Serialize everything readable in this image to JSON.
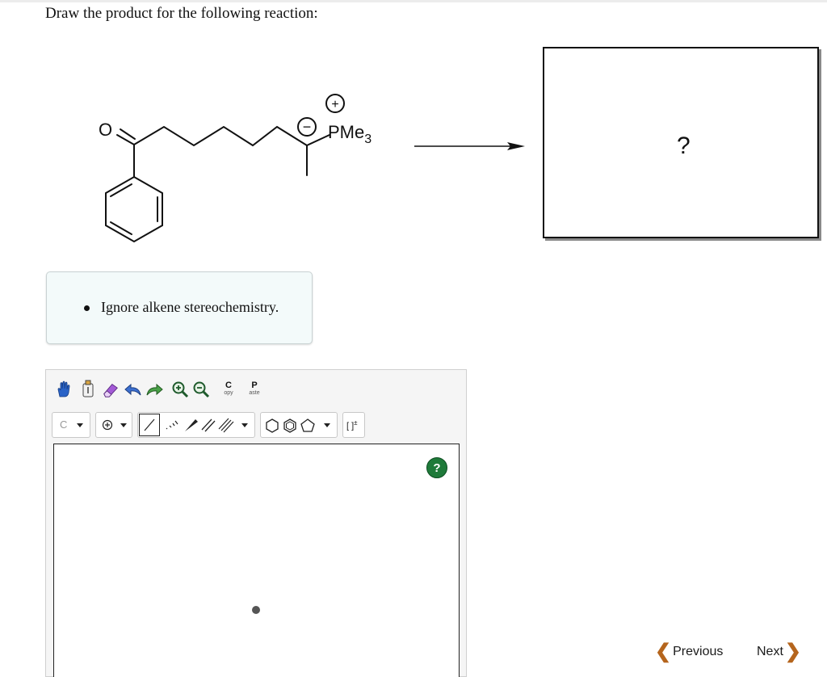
{
  "question": {
    "text": "Draw the product for the following reaction:"
  },
  "molecule": {
    "atom_o": "O",
    "charge_plus": "+",
    "charge_minus": "−",
    "reagent": "PMe",
    "reagent_sub": "3"
  },
  "answer_box": {
    "placeholder": "?"
  },
  "hint": {
    "text": "Ignore alkene stereochemistry."
  },
  "editor": {
    "toolbar": {
      "copy_top": "C",
      "copy_bottom": "opy",
      "paste_top": "P",
      "paste_bottom": "aste",
      "element": "C",
      "bracket": "[ ]",
      "bracket_sup": "±"
    },
    "help_label": "?"
  },
  "navigation": {
    "previous": "Previous",
    "next": "Next"
  },
  "colors": {
    "help_green": "#1f7a3a",
    "nav_chevron": "#b5651d",
    "hint_bg": "#f3fafa"
  }
}
